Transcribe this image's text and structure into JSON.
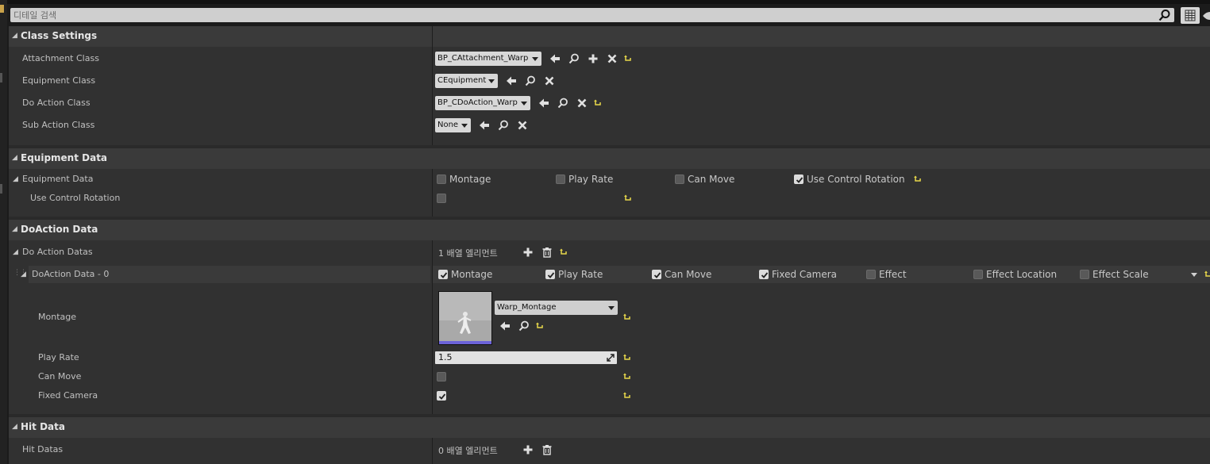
{
  "search": {
    "placeholder": "디테일 검색"
  },
  "categories": {
    "class_settings": "Class Settings",
    "equipment_data": "Equipment Data",
    "doaction_data": "DoAction Data",
    "hit_data": "Hit Data"
  },
  "class_settings": {
    "attachment": {
      "label": "Attachment Class",
      "value": "BP_CAttachment_Warp"
    },
    "equipment": {
      "label": "Equipment Class",
      "value": "CEquipment"
    },
    "do_action": {
      "label": "Do Action Class",
      "value": "BP_CDoAction_Warp"
    },
    "sub_action": {
      "label": "Sub Action Class",
      "value": "None"
    }
  },
  "equipment_data": {
    "struct_label": "Equipment Data",
    "fields": [
      {
        "label": "Montage",
        "checked": false
      },
      {
        "label": "Play Rate",
        "checked": false
      },
      {
        "label": "Can Move",
        "checked": false
      },
      {
        "label": "Use Control Rotation",
        "checked": true
      }
    ],
    "use_control_rotation": {
      "label": "Use Control Rotation",
      "checked": false
    }
  },
  "doaction_data": {
    "array_label": "Do Action Datas",
    "array_count": "1 배열 엘리먼트",
    "element_label": "DoAction Data - 0",
    "fields": [
      {
        "label": "Montage",
        "checked": true
      },
      {
        "label": "Play Rate",
        "checked": true
      },
      {
        "label": "Can Move",
        "checked": true
      },
      {
        "label": "Fixed Camera",
        "checked": true
      },
      {
        "label": "Effect",
        "checked": false
      },
      {
        "label": "Effect Location",
        "checked": false
      },
      {
        "label": "Effect Scale",
        "checked": false
      }
    ],
    "montage": {
      "label": "Montage",
      "value": "Warp_Montage"
    },
    "play_rate": {
      "label": "Play Rate",
      "value": "1.5"
    },
    "can_move": {
      "label": "Can Move",
      "checked": false
    },
    "fixed_camera": {
      "label": "Fixed Camera",
      "checked": true
    }
  },
  "hit_data": {
    "array_label": "Hit Datas",
    "array_count": "0 배열 엘리먼트"
  },
  "colors": {
    "reset_arrow": "#e8d84a",
    "panel_bg": "#313131",
    "category_bg": "#3a3a3a"
  }
}
